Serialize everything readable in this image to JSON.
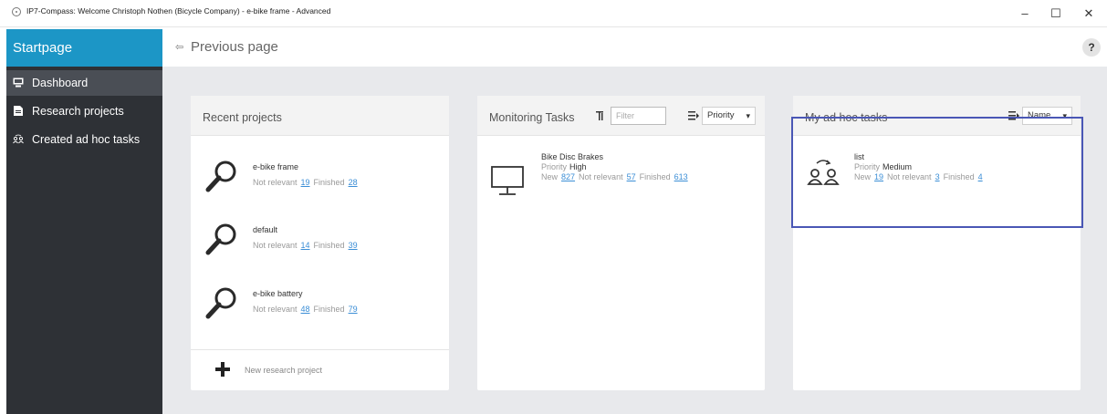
{
  "window": {
    "title": "IP7-Compass: Welcome Christoph Nothen (Bicycle Company) - e-bike frame - Advanced",
    "minimize": "–",
    "maximize": "☐",
    "close": "✕"
  },
  "sidebar": {
    "header": "Startpage",
    "items": [
      {
        "label": "Dashboard",
        "icon": "monitor-icon",
        "selected": true
      },
      {
        "label": "Research projects",
        "icon": "document-icon"
      },
      {
        "label": "Created ad hoc tasks",
        "icon": "people-icon"
      }
    ]
  },
  "topbar": {
    "previous": "Previous page",
    "help": "?"
  },
  "recent": {
    "title": "Recent projects",
    "projects": [
      {
        "name": "e-bike frame",
        "not_relevant_label": "Not relevant",
        "not_relevant": "19",
        "finished_label": "Finished",
        "finished": "28"
      },
      {
        "name": "default",
        "not_relevant_label": "Not relevant",
        "not_relevant": "14",
        "finished_label": "Finished",
        "finished": "39"
      },
      {
        "name": "e-bike battery",
        "not_relevant_label": "Not relevant",
        "not_relevant": "48",
        "finished_label": "Finished",
        "finished": "79"
      }
    ],
    "new_project": "New research project"
  },
  "monitoring": {
    "title": "Monitoring Tasks",
    "filter_placeholder": "Filter",
    "sort_value": "Priority",
    "task": {
      "name": "Bike Disc Brakes",
      "priority_label": "Priority",
      "priority": "High",
      "new_label": "New",
      "new": "827",
      "not_relevant_label": "Not relevant",
      "not_relevant": "57",
      "finished_label": "Finished",
      "finished": "613"
    }
  },
  "adhoc": {
    "title": "My ad hoc tasks",
    "sort_value": "Name",
    "task": {
      "name": "list",
      "priority_label": "Priority",
      "priority": "Medium",
      "new_label": "New",
      "new": "19",
      "not_relevant_label": "Not relevant",
      "not_relevant": "3",
      "finished_label": "Finished",
      "finished": "4"
    }
  },
  "colors": {
    "accent": "#1c96c6",
    "sidebar": "#2e3136",
    "highlight": "#4a57b5",
    "link": "#3b8ed6"
  }
}
